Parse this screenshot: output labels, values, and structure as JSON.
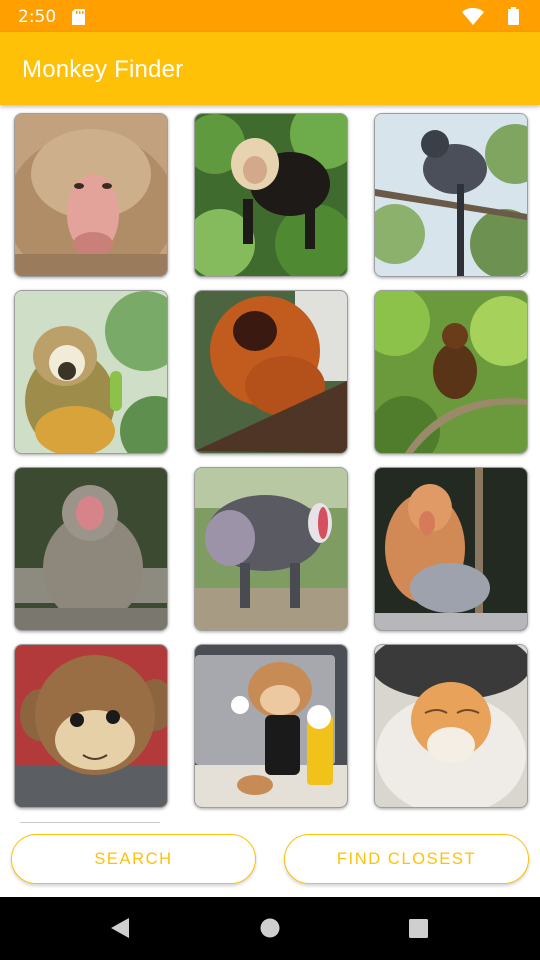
{
  "status_bar": {
    "time": "2:50",
    "icons": [
      "sd-card-icon",
      "wifi-icon",
      "battery-icon"
    ]
  },
  "app_bar": {
    "title": "Monkey Finder"
  },
  "gallery": {
    "items": [
      {
        "subject": "baboon"
      },
      {
        "subject": "capuchin"
      },
      {
        "subject": "blue-monkey"
      },
      {
        "subject": "squirrel-monkey"
      },
      {
        "subject": "golden-lion-tamarin"
      },
      {
        "subject": "howler-monkey"
      },
      {
        "subject": "japanese-macaque"
      },
      {
        "subject": "mandrill"
      },
      {
        "subject": "proboscis-monkey"
      },
      {
        "subject": "plush-monkey"
      },
      {
        "subject": "plush-monkey-with-laptop"
      },
      {
        "subject": "doc-langur"
      }
    ]
  },
  "buttons": {
    "search": "SEARCH",
    "find_closest": "FIND CLOSEST"
  },
  "nav_bar": {
    "icons": [
      "back-icon",
      "home-icon",
      "recents-icon"
    ]
  },
  "colors": {
    "status_bar": "#FFA000",
    "app_bar": "#FFC107",
    "accent": "#FFC107",
    "nav_bar": "#000000"
  }
}
